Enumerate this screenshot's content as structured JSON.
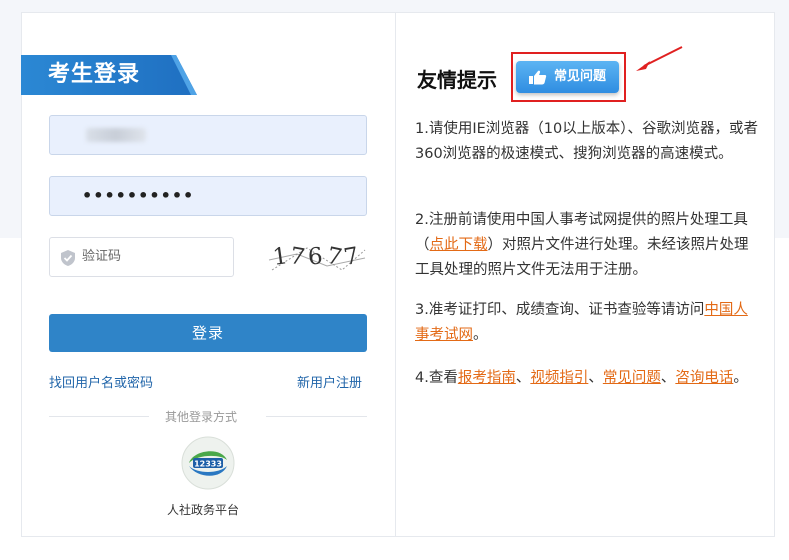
{
  "login": {
    "title": "考生登录",
    "username_value": "",
    "password_value": "••••••••••",
    "captcha_placeholder": "验证码",
    "captcha_text": [
      "1",
      "7",
      "6",
      "7",
      "7"
    ],
    "login_button": "登录",
    "forgot_link": "找回用户名或密码",
    "register_link": "新用户注册",
    "other_methods_label": "其他登录方式",
    "platform_label": "人社政务平台"
  },
  "tips": {
    "title": "友情提示",
    "faq_button": "常见问题",
    "item1": "1.请使用IE浏览器（10以上版本）、谷歌浏览器，或者360浏览器的极速模式、搜狗浏览器的高速模式。",
    "item2_prefix": "2.注册前请使用中国人事考试网提供的照片处理工具（",
    "item2_link": "点此下载",
    "item2_suffix": "）对照片文件进行处理。未经该照片处理工具处理的照片文件无法用于注册。",
    "item3_prefix": "3.准考证打印、成绩查询、证书查验等请访问",
    "item3_link": "中国人事考试网",
    "item3_suffix": "。",
    "item4_prefix": "4.查看",
    "item4_link1": "报考指南",
    "item4_sep1": "、",
    "item4_link2": "视频指引",
    "item4_sep2": "、",
    "item4_link3": "常见问题",
    "item4_sep3": "、",
    "item4_link4": "咨询电话",
    "item4_suffix": "。"
  },
  "colors": {
    "primary": "#2f84c8",
    "link_orange": "#e36a16",
    "highlight_red": "#e02020"
  }
}
